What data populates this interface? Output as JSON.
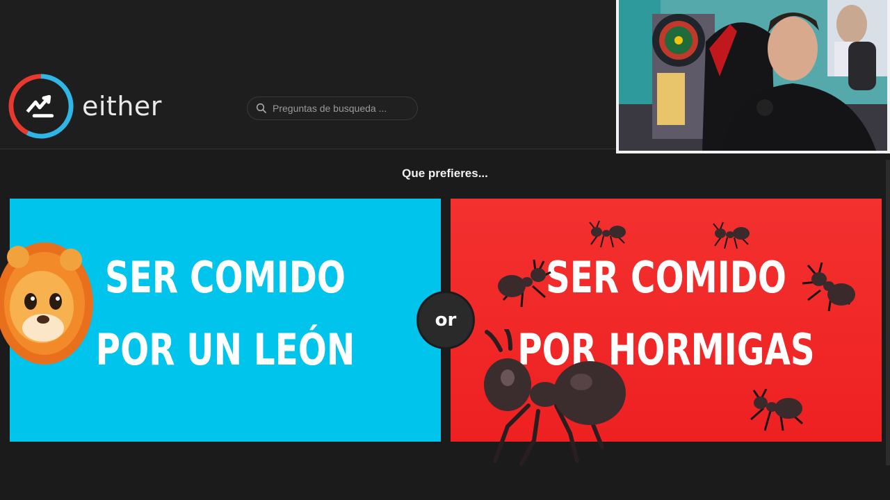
{
  "header": {
    "logo_text": "either",
    "search_placeholder": "Preguntas de busqueda ..."
  },
  "main": {
    "question": "Que prefieres...",
    "option_a": {
      "line1": "SER COMIDO",
      "line2": "POR UN LEÓN",
      "color": "#00c4ec"
    },
    "option_b": {
      "line1": "SER COMIDO",
      "line2": "POR HORMIGAS",
      "color": "#f12a2a"
    },
    "divider_label": "or"
  },
  "icons": {
    "logo": "either-logo-icon",
    "search": "search-icon",
    "lion": "lion-emoji-icon",
    "ant": "ant-emoji-icon"
  },
  "colors": {
    "background": "#1b1b1c",
    "logo_red": "#e8392f",
    "logo_blue": "#2fb6e6"
  }
}
